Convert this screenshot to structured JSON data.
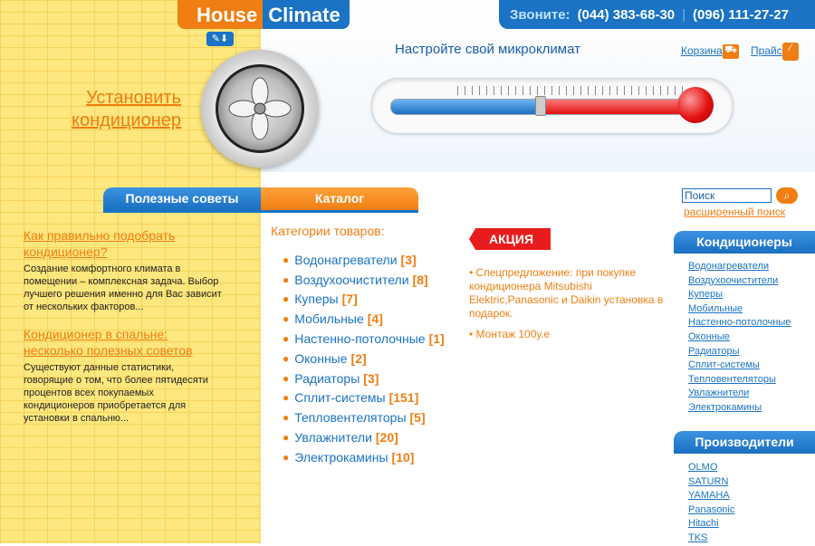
{
  "header": {
    "logo_house": "House",
    "logo_climate": "Climate",
    "phones_label": "Звоните:",
    "phone1": "(044) 383-68-30",
    "phone2": "(096) 111-27-27",
    "separator": "|",
    "subtitle": "Настройте свой микроклимат",
    "cart_label": "Корзина",
    "price_label": "Прайс"
  },
  "hero": {
    "install_line1": "Установить",
    "install_line2": "кондиционер"
  },
  "tabs": {
    "tips": "Полезные советы",
    "catalog": "Каталог"
  },
  "articles": [
    {
      "title": "Как правильно подобрать кондиционер?",
      "text": "Создание комфортного климата в помещении – комплексная задача. Выбор лучшего решения именно для Вас зависит от нескольких факторов..."
    },
    {
      "title": "Кондиционер в спальне: несколько полезных советов",
      "text": "Существуют данные статистики, говорящие о том, что более пятидесяти процентов всех покупаемых кондиционеров приобретается для установки в спальню..."
    }
  ],
  "catalog": {
    "heading": "Категории товаров:",
    "items": [
      {
        "name": "Водонагреватели",
        "count": "[3]"
      },
      {
        "name": "Воздухоочистители",
        "count": "[8]"
      },
      {
        "name": "Куперы",
        "count": "[7]"
      },
      {
        "name": "Мобильные",
        "count": "[4]"
      },
      {
        "name": "Настенно-потолочные",
        "count": "[1]"
      },
      {
        "name": "Оконные",
        "count": "[2]"
      },
      {
        "name": "Радиаторы",
        "count": "[3]"
      },
      {
        "name": "Сплит-системы",
        "count": "[151]"
      },
      {
        "name": "Тепловентеляторы",
        "count": "[5]"
      },
      {
        "name": "Увлажнители",
        "count": "[20]"
      },
      {
        "name": "Электрокамины",
        "count": "[10]"
      }
    ]
  },
  "promo": {
    "badge": "АКЦИЯ",
    "item1": "• Спецпредложение: при покупке кондиционера Mitsubishi Elektric,Panasonic и Daikin установка в подарок.",
    "item2": "• Монтаж 100у.е"
  },
  "search": {
    "value": "Поиск",
    "advanced": "расширенный поиск"
  },
  "sidebar": {
    "conditioners_title": "Кондиционеры",
    "conditioners": [
      "Водонагреватели",
      "Воздухоочистители",
      "Куперы",
      "Мобильные",
      "Настенно-потолочные",
      "Оконные",
      "Радиаторы",
      "Сплит-системы",
      "Тепловентеляторы",
      "Увлажнители",
      "Электрокамины"
    ],
    "makers_title": "Производители",
    "makers": [
      "OLMO",
      "SATURN",
      "YAMAHA",
      "Panasonic",
      "Hitachi",
      "TKS"
    ]
  },
  "thermometer": {
    "level": 0.5
  },
  "colors": {
    "orange": "#f07e12",
    "blue": "#1a73c4",
    "yellow": "#fde77e",
    "red": "#e81c1c"
  },
  "icons": {
    "cart": "cart-icon",
    "price": "price-icon",
    "search": "search-icon",
    "fan": "fan-icon"
  }
}
